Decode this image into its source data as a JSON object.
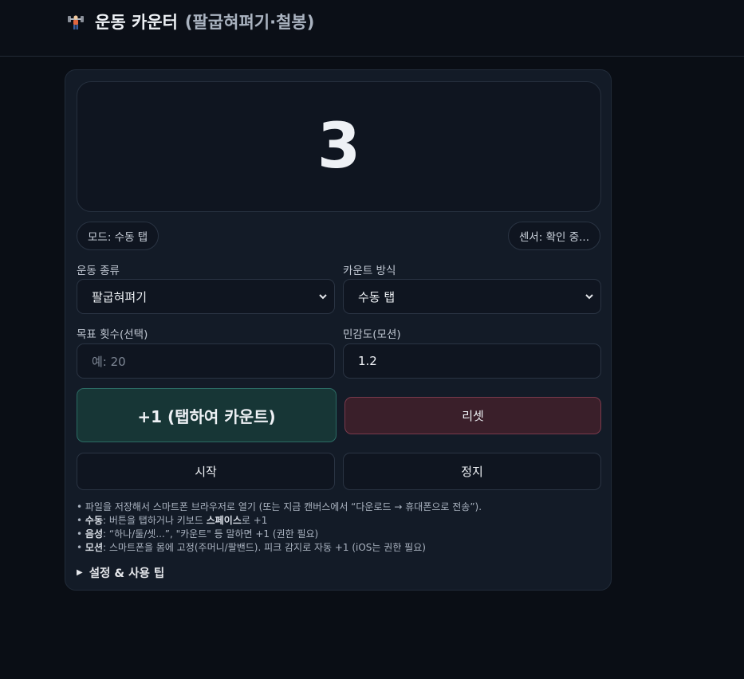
{
  "header": {
    "title": "운동 카운터",
    "subtitle": "(팔굽혀펴기·철봉)",
    "icon": "weightlifter-icon"
  },
  "counter": {
    "value": "3"
  },
  "status": {
    "mode": "모드: 수동 탭",
    "sensor": "센서: 확인 중..."
  },
  "form": {
    "exercise_label": "운동 종류",
    "exercise_value": "팔굽혀펴기",
    "count_method_label": "카운트 방식",
    "count_method_value": "수동 탭",
    "target_label": "목표 횟수(선택)",
    "target_placeholder": "예: 20",
    "sensitivity_label": "민감도(모션)",
    "sensitivity_value": "1.2"
  },
  "buttons": {
    "count": "+1 (탭하여 카운트)",
    "reset": "리셋",
    "start": "시작",
    "stop": "정지"
  },
  "help": {
    "line1": "• 파일을 저장해서 스마트폰 브라우저로 열기 (또는 지금 캔버스에서 “다운로드 → 휴대폰으로 전송”).",
    "line2_bold": "수동",
    "line2_a": ": 버튼을 탭하거나 키보드 ",
    "line2_bold2": "스페이스",
    "line2_b": "로 +1",
    "line3_bold": "음성",
    "line3": ": “하나/둘/셋...”, \"카운트\" 등 말하면 +1 (권한 필요)",
    "line4_bold": "모션",
    "line4": ": 스마트폰을 몸에 고정(주머니/팔밴드). 피크 감지로 자동 +1 (iOS는 권한 필요)"
  },
  "details": {
    "summary": "설정 & 사용 팁"
  },
  "colors": {
    "background": "#0a0e15",
    "card": "#131b27",
    "count_button": "#173636",
    "reset_button": "#3a1f2a"
  }
}
